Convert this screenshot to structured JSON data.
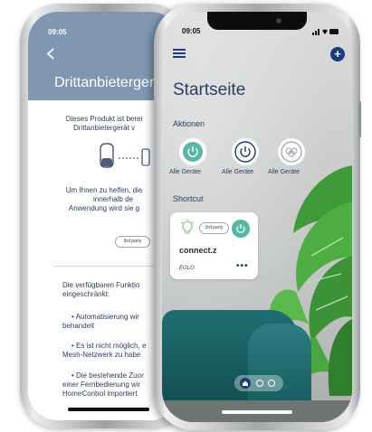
{
  "back_screen": {
    "time": "09:05",
    "title": "Drittanbieterger",
    "intro_lines": [
      "Dieses Produkt ist berei",
      "Drittanbietergerät v"
    ],
    "help_lines": [
      "Um Ihnen zu helfen, die",
      "innerhalb de",
      "Anwendung wird sie g"
    ],
    "badge": "3rd party",
    "func_lines": [
      "Die verfügbaren Funktio",
      "eingeschränkt:"
    ],
    "bullet1": [
      "• Automatisierung wir",
      "behandelt"
    ],
    "bullet2": [
      "• Es ist nicht möglich, e",
      "Mesh-Netzwerk zu habe"
    ],
    "bullet3": [
      "• Die bestehende Zuor",
      "einer Fernbedienung wir",
      "HomeControl importiert"
    ]
  },
  "front_screen": {
    "time": "09:05",
    "page_title": "Startseite",
    "actions_label": "Aktionen",
    "actions": [
      {
        "label": "Alle Geräte",
        "icon": "power-icon",
        "style": "filled-teal"
      },
      {
        "label": "Alle Geräte",
        "icon": "power-icon",
        "style": "outline-navy"
      },
      {
        "label": "Alle Geräte",
        "icon": "scene-icon",
        "style": "outline-grey"
      }
    ],
    "shortcut_label": "Shortcut",
    "shortcut_card": {
      "badge": "3rd party",
      "name": "connect.z",
      "brand": "EGLO",
      "more": "•••"
    }
  },
  "colors": {
    "accent_teal": "#54b8a3",
    "navy": "#1b3d7a",
    "header_blue": "#7f97b1",
    "text": "#2b3e63"
  }
}
